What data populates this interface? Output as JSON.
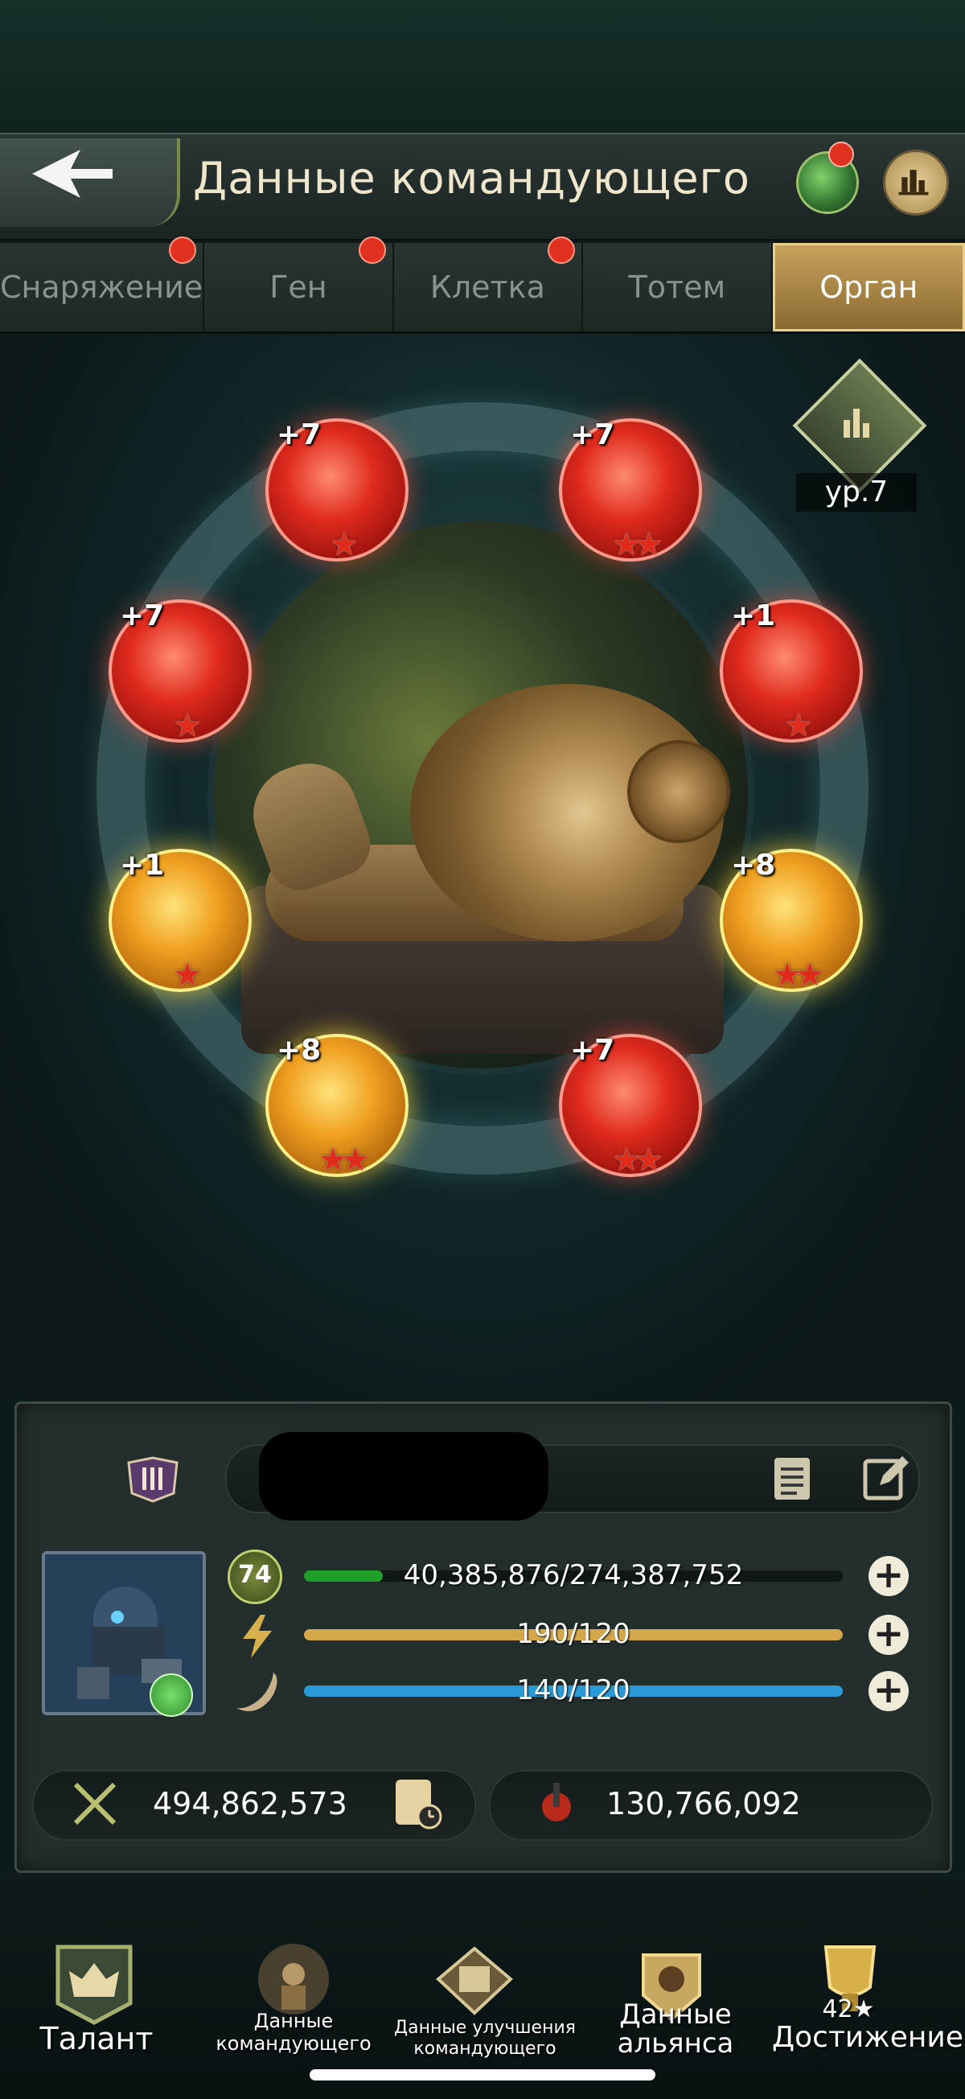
{
  "header": {
    "title": "Данные командующего",
    "back_icon": "back-arrow-icon",
    "globe_icon": "globe-icon",
    "rank_icon": "rank-icon"
  },
  "tabs": [
    {
      "label": "Снаряжение",
      "dot": true,
      "active": false
    },
    {
      "label": "Ген",
      "dot": true,
      "active": false
    },
    {
      "label": "Клетка",
      "dot": true,
      "active": false
    },
    {
      "label": "Тотем",
      "dot": false,
      "active": false
    },
    {
      "label": "Орган",
      "dot": false,
      "active": true
    }
  ],
  "organs": [
    {
      "level": "+7",
      "stars": "★",
      "color": "red"
    },
    {
      "level": "+7",
      "stars": "★★",
      "color": "red"
    },
    {
      "level": "+7",
      "stars": "★",
      "color": "red"
    },
    {
      "level": "+1",
      "stars": "★",
      "color": "red"
    },
    {
      "level": "+1",
      "stars": "★",
      "color": "gold"
    },
    {
      "level": "+8",
      "stars": "★★",
      "color": "gold"
    },
    {
      "level": "+8",
      "stars": "★★",
      "color": "gold"
    },
    {
      "level": "+7",
      "stars": "★★",
      "color": "red"
    }
  ],
  "organ_level": "ур.7",
  "commander": {
    "level": "74",
    "exp_text": "40,385,876/274,387,752",
    "exp_progress": 0.147,
    "energy_text": "190/120",
    "energy_progress": 1.0,
    "stamina_text": "140/120",
    "stamina_progress": 1.0,
    "power": "494,862,573",
    "kills": "130,766,092"
  },
  "nav": {
    "talent": "Талант",
    "commander_data": "Данные командующего",
    "upgrade_data": "Данные улучшения командующего",
    "alliance_data": "Данные альянса",
    "achievement": "Достижение",
    "achievement_count": "42★"
  },
  "colors": {
    "exp_bar": "#20a02a",
    "energy_bar": "#d4a84a",
    "stamina_bar": "#2a9ad6",
    "active_tab": "#c7a25c",
    "notification_dot": "#e03020"
  }
}
